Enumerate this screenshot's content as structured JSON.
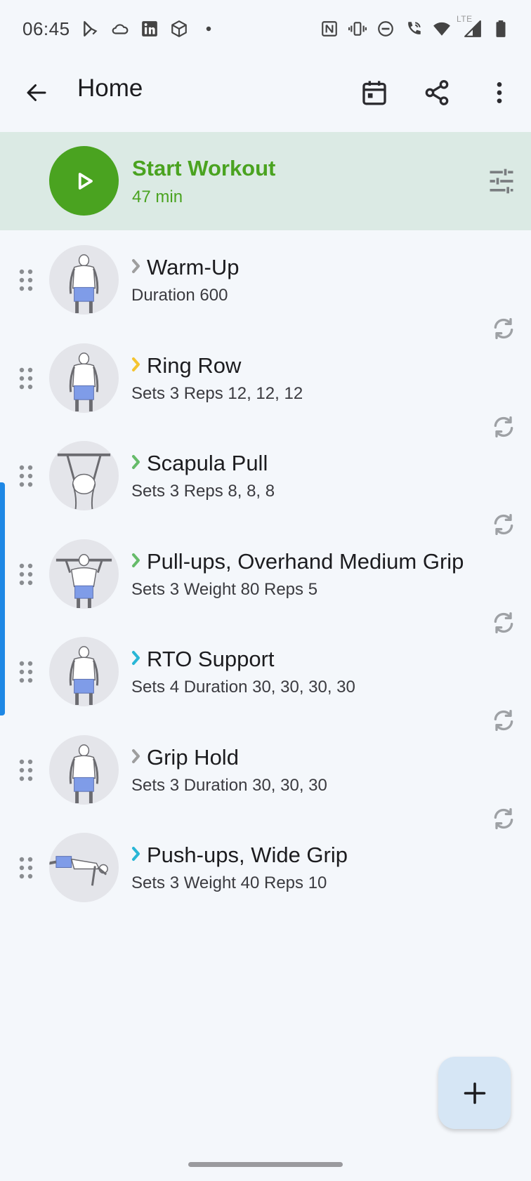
{
  "status_bar": {
    "time": "06:45",
    "left_icons": [
      "play-store-icon",
      "cloud-icon",
      "linkedin-icon",
      "box-icon",
      "dot-icon"
    ],
    "right_icons": [
      "nfc-icon",
      "vibrate-icon",
      "do-not-disturb-icon",
      "wifi-calling-icon",
      "wifi-icon",
      "lte-signal-icon",
      "battery-icon"
    ],
    "network_label": "LTE"
  },
  "app_bar": {
    "title": "Home",
    "actions": [
      "calendar-icon",
      "share-icon",
      "more-vert-icon"
    ]
  },
  "start_workout": {
    "label": "Start Workout",
    "duration": "47 min",
    "accent_color": "#4aa320",
    "background": "#dbeae4"
  },
  "exercises": [
    {
      "name": "Warm-Up",
      "detail": "Duration 600",
      "chevron_color": "#9e9e9e",
      "figure": "standing"
    },
    {
      "name": "Ring Row",
      "detail": "Sets 3 Reps 12, 12, 12",
      "chevron_color": "#f4c430",
      "figure": "standing"
    },
    {
      "name": "Scapula Pull",
      "detail": "Sets 3 Reps 8, 8, 8",
      "chevron_color": "#66bb6a",
      "figure": "hanging"
    },
    {
      "name": "Pull-ups, Overhand Medium Grip",
      "detail": "Sets 3 Weight 80 Reps 5",
      "chevron_color": "#66bb6a",
      "figure": "pullup"
    },
    {
      "name": "RTO Support",
      "detail": "Sets 4 Duration 30, 30, 30, 30",
      "chevron_color": "#29b6d6",
      "figure": "standing"
    },
    {
      "name": "Grip Hold",
      "detail": "Sets 3 Duration 30, 30, 30",
      "chevron_color": "#9e9e9e",
      "figure": "standing"
    },
    {
      "name": "Push-ups, Wide Grip",
      "detail": "Sets 3 Weight 40 Reps 10",
      "chevron_color": "#29b6d6",
      "figure": "pushup"
    }
  ],
  "fab": {
    "icon": "add-icon"
  }
}
